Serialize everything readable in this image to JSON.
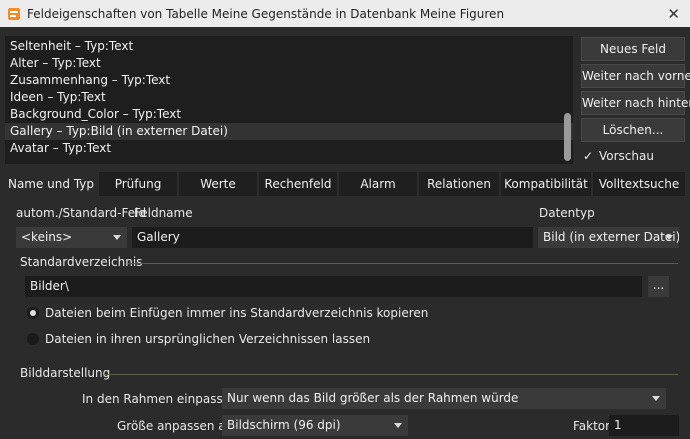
{
  "window": {
    "title": "Feldeigenschaften von Tabelle Meine Gegenstände in Datenbank Meine Figuren",
    "close_glyph": "✕"
  },
  "fields": [
    {
      "label": "Seltenheit – Typ:Text"
    },
    {
      "label": "Alter – Typ:Text"
    },
    {
      "label": "Zusammenhang – Typ:Text"
    },
    {
      "label": "Ideen – Typ:Text"
    },
    {
      "label": "Background_Color – Typ:Text"
    },
    {
      "label": "Gallery – Typ:Bild (in externer Datei)",
      "selected": true
    },
    {
      "label": "Avatar – Typ:Text"
    }
  ],
  "side_buttons": {
    "new_field": "Neues Feld",
    "move_forward": "Weiter nach vorne",
    "move_back": "Weiter nach hinten",
    "delete": "Löschen...",
    "preview_label": "Vorschau",
    "preview_checked": true
  },
  "tabs": [
    "Name und Typ",
    "Prüfung",
    "Werte",
    "Rechenfeld",
    "Alarm",
    "Relationen",
    "Kompatibilität",
    "Volltextsuche"
  ],
  "form": {
    "auto_field_label": "autom./Standard-Feld",
    "auto_field_value": "<keins>",
    "fieldname_label": "Feldname",
    "fieldname_value": "Gallery",
    "datatype_label": "Datentyp",
    "datatype_value": "Bild (in externer Datei)",
    "std_dir_section": "Standardverzeichnis",
    "std_dir_value": "Bilder\\",
    "browse_label": "...",
    "radio_copy": "Dateien beim Einfügen immer ins Standardverzeichnis kopieren",
    "radio_keep": "Dateien in ihren ursprünglichen Verzeichnissen lassen",
    "image_section": "Bilddarstellung",
    "fit_label": "In den Rahmen einpassen:",
    "fit_value": "Nur wenn das Bild größer als der Rahmen würde",
    "size_label": "Größe anpassen an:",
    "size_value": "Bildschirm (96 dpi)",
    "factor_label": "Faktor",
    "factor_value": "1"
  }
}
